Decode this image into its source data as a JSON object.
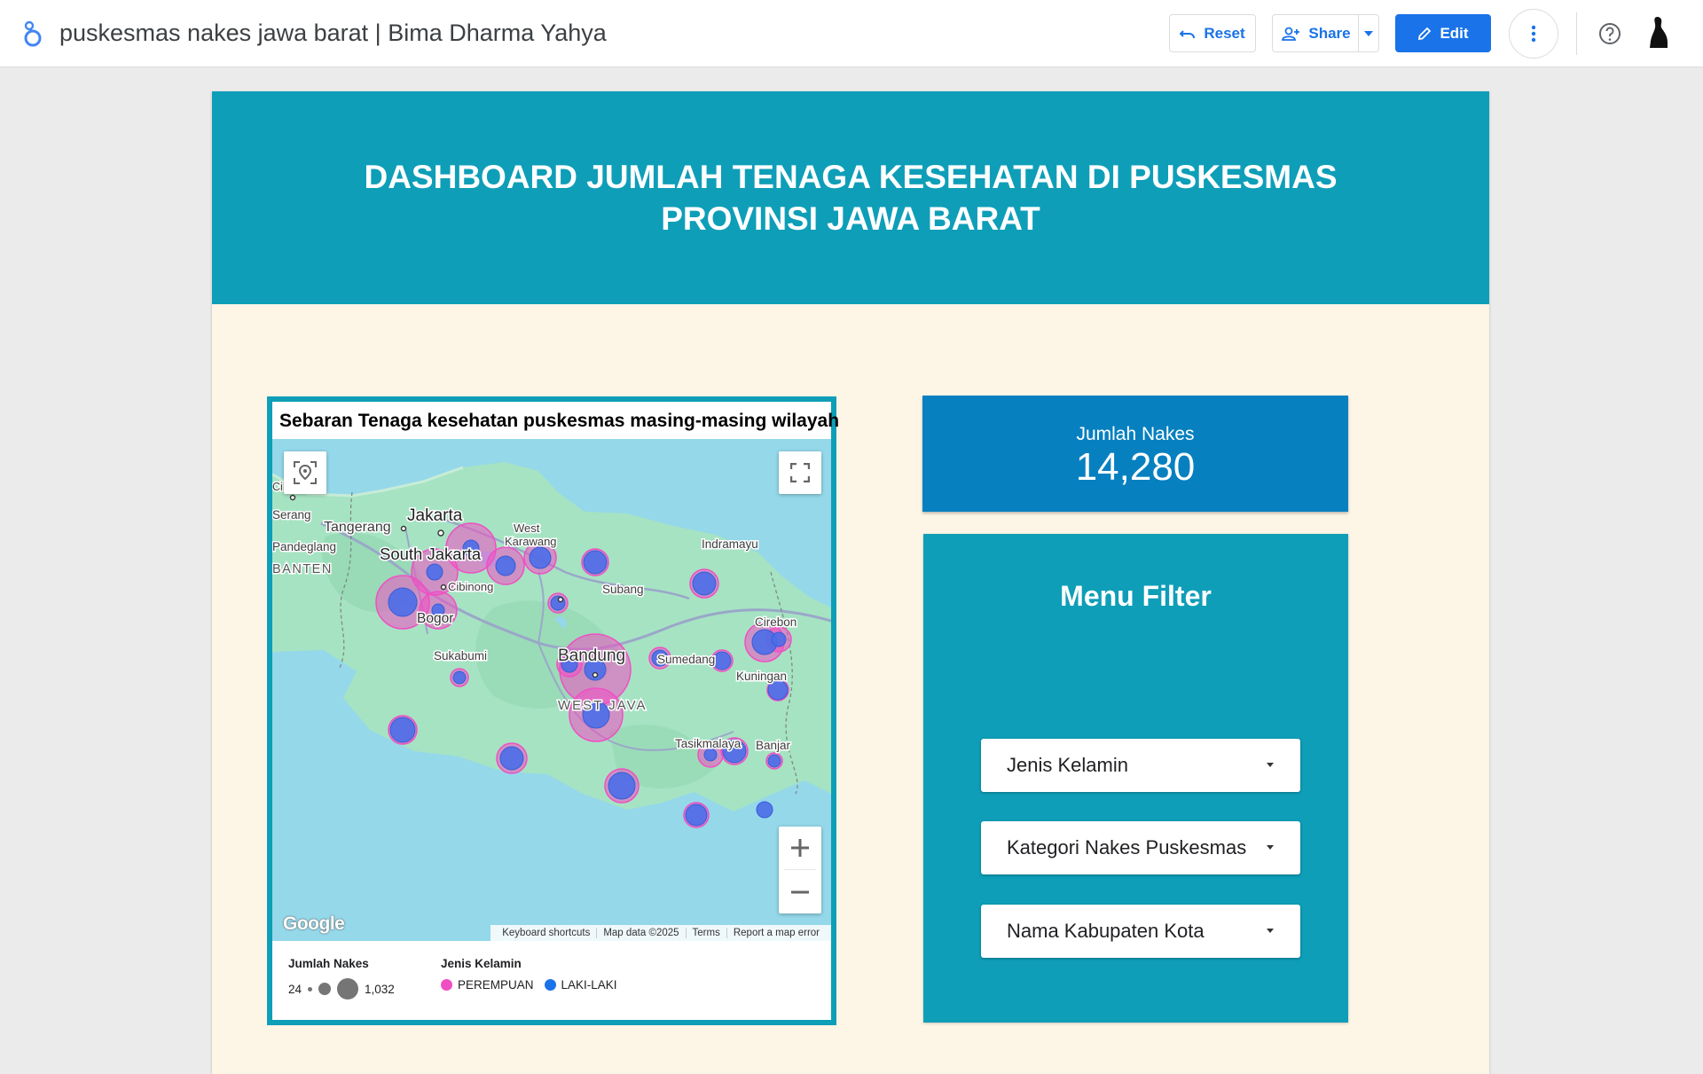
{
  "topbar": {
    "title": "puskesmas nakes jawa barat | Bima Dharma Yahya",
    "reset_label": "Reset",
    "share_label": "Share",
    "edit_label": "Edit",
    "icons": [
      "looker-studio-logo-icon",
      "undo-icon",
      "add-person-icon",
      "chevron-down-icon",
      "pencil-icon",
      "more-vert-icon",
      "help-icon",
      "avatar"
    ]
  },
  "header": {
    "title": "DASHBOARD JUMLAH TENAGA KESEHATAN DI PUSKESMAS PROVINSI JAWA BARAT"
  },
  "map": {
    "title": "Sebaran Tenaga kesehatan puskesmas masing-masing wilayah",
    "place_labels": [
      "Jakarta",
      "Tangerang",
      "West Karawang",
      "South Jakarta",
      "Pandeglang",
      "BANTEN",
      "Cibinong",
      "Bogor",
      "Indramayu",
      "Subang",
      "Cirebon",
      "Sumedang",
      "Bandung",
      "Sukabumi",
      "Kuningan",
      "WEST JAVA",
      "Tasikmalaya",
      "Banjar",
      "Serang",
      "Ci"
    ],
    "google_logo": "Google",
    "attribution": [
      "Keyboard shortcuts",
      "Map data ©2025",
      "Terms",
      "Report a map error"
    ],
    "legend": {
      "size_title": "Jumlah Nakes",
      "size_min": "24",
      "size_max": "1,032",
      "color_title": "Jenis Kelamin",
      "categories": [
        "PEREMPUAN",
        "LAKI-LAKI"
      ]
    },
    "colors": {
      "perempuan": "#f04fc3",
      "laki_laki": "#4a6ee8",
      "water": "#94d8ea",
      "land": "#a6e3c3"
    }
  },
  "scorecard": {
    "label": "Jumlah Nakes",
    "value": "14,280"
  },
  "filter": {
    "title": "Menu Filter",
    "dropdowns": [
      "Jenis Kelamin",
      "Kategori Nakes Puskesmas",
      "Nama Kabupaten Kota"
    ]
  },
  "theme": {
    "header_band": "#0e9eb8",
    "canvas": "#fdf5e6",
    "scorecard_bg": "#0780c0",
    "accent_blue": "#1a73e8"
  }
}
